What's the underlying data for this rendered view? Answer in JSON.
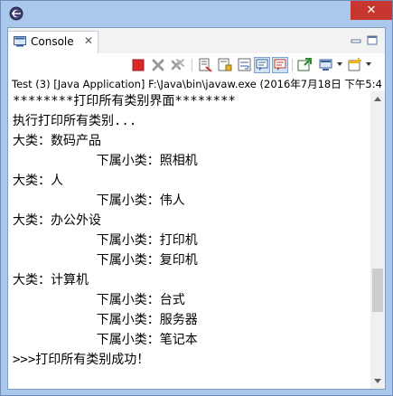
{
  "window": {
    "close_glyph": "✕"
  },
  "view": {
    "tab_label": "Console",
    "tab_close_glyph": "✕"
  },
  "launch": {
    "description": "Test (3) [Java Application] F:\\Java\\bin\\javaw.exe (2016年7月18日 下午5:4"
  },
  "console": {
    "lines": [
      "********打印所有类别界面********",
      "执行打印所有类别...",
      "大类：数码产品",
      "           下属小类：照相机",
      "大类：人",
      "           下属小类：伟人",
      "大类：办公外设",
      "           下属小类：打印机",
      "           下属小类：复印机",
      "大类：计算机",
      "           下属小类：台式",
      "           下属小类：服务器",
      "           下属小类：笔记本",
      ">>>打印所有类别成功！"
    ]
  },
  "scrollbar": {
    "position_fraction": 0.72
  },
  "colors": {
    "window_frame": "#aac8ec",
    "close_button": "#c7362f",
    "terminate_red": "#d9292b"
  },
  "icons": {
    "app": "eclipse-icon",
    "console": "console-icon",
    "terminate": "terminate-icon",
    "remove_launch": "remove-launch-icon",
    "remove_all": "remove-all-launches-icon",
    "clear": "clear-console-icon",
    "scroll_lock": "scroll-lock-icon",
    "word_wrap": "word-wrap-icon",
    "show_stdout": "show-stdout-icon",
    "show_stderr": "show-stderr-icon",
    "pin": "pin-console-icon",
    "display_selected": "display-selected-console-icon",
    "open_console": "open-console-icon",
    "minimize": "minimize-icon",
    "maximize": "maximize-icon"
  }
}
